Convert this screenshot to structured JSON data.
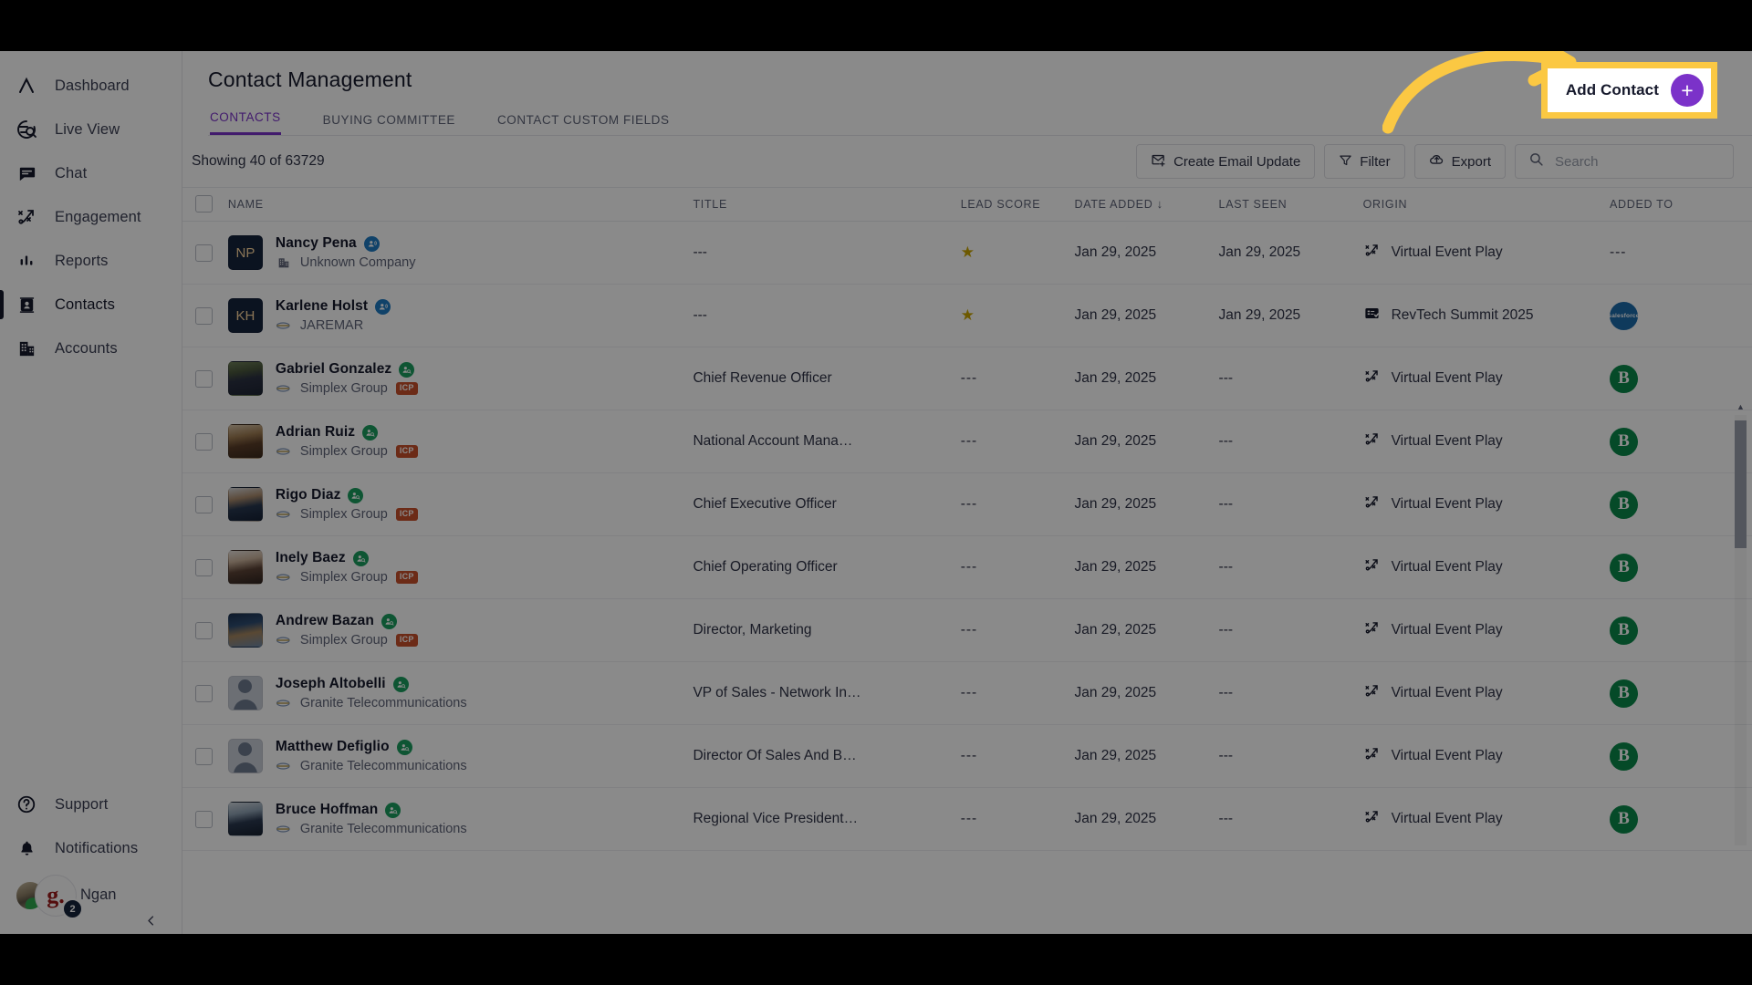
{
  "sidebar": {
    "items": [
      {
        "label": "Dashboard",
        "icon": "dashboard-icon",
        "active": false
      },
      {
        "label": "Live View",
        "icon": "live-view-icon",
        "active": false
      },
      {
        "label": "Chat",
        "icon": "chat-icon",
        "active": false
      },
      {
        "label": "Engagement",
        "icon": "engagement-icon",
        "active": false
      },
      {
        "label": "Reports",
        "icon": "reports-icon",
        "active": false
      },
      {
        "label": "Contacts",
        "icon": "contacts-icon",
        "active": true
      },
      {
        "label": "Accounts",
        "icon": "accounts-icon",
        "active": false
      }
    ],
    "support": "Support",
    "notifications": "Notifications",
    "user": {
      "name": "Ngan",
      "badge_count": "2",
      "avatar_initial": "g."
    }
  },
  "header": {
    "title": "Contact Management",
    "tabs": [
      {
        "label": "CONTACTS",
        "active": true
      },
      {
        "label": "BUYING COMMITTEE",
        "active": false
      },
      {
        "label": "CONTACT CUSTOM FIELDS",
        "active": false
      }
    ],
    "add_contact_label": "Add Contact",
    "add_contact_plus": "+"
  },
  "toolbar": {
    "showing": "Showing 40 of  63729",
    "create_email_update": "Create Email Update",
    "filter": "Filter",
    "export": "Export",
    "search_placeholder": "Search",
    "search_value": ""
  },
  "table": {
    "columns": [
      "NAME",
      "TITLE",
      "LEAD SCORE",
      "DATE ADDED",
      "LAST SEEN",
      "ORIGIN",
      "ADDED TO"
    ],
    "sort_column": "DATE ADDED",
    "sort_dir": "↓",
    "rows": [
      {
        "name": "Nancy Pena",
        "avatar_type": "initials",
        "initials": "NP",
        "pill": "blue",
        "company": "Unknown Company",
        "company_icon": "building-icon",
        "icp": false,
        "title": "---",
        "lead_score": "star",
        "date_added": "Jan 29, 2025",
        "last_seen": "Jan 29, 2025",
        "origin": "Virtual Event Play",
        "origin_icon": "play-icon",
        "added_to": "---"
      },
      {
        "name": "Karlene Holst",
        "avatar_type": "initials",
        "initials": "KH",
        "pill": "blue",
        "company": "JAREMAR",
        "company_icon": "logo-icon",
        "icp": false,
        "title": "---",
        "lead_score": "star",
        "date_added": "Jan 29, 2025",
        "last_seen": "Jan 29, 2025",
        "origin": "RevTech Summit 2025",
        "origin_icon": "form-icon",
        "added_to": "salesforce"
      },
      {
        "name": "Gabriel Gonzalez",
        "avatar_type": "photo-1",
        "initials": "",
        "pill": "green",
        "company": "Simplex Group",
        "company_icon": "logo-icon",
        "icp": true,
        "title": "Chief Revenue Officer",
        "lead_score": "---",
        "date_added": "Jan 29, 2025",
        "last_seen": "---",
        "origin": "Virtual Event Play",
        "origin_icon": "play-icon",
        "added_to": "bombora"
      },
      {
        "name": "Adrian Ruiz",
        "avatar_type": "photo-2",
        "initials": "",
        "pill": "green",
        "company": "Simplex Group",
        "company_icon": "logo-icon",
        "icp": true,
        "title": "National Account Mana…",
        "lead_score": "---",
        "date_added": "Jan 29, 2025",
        "last_seen": "---",
        "origin": "Virtual Event Play",
        "origin_icon": "play-icon",
        "added_to": "bombora"
      },
      {
        "name": "Rigo Diaz",
        "avatar_type": "photo-3",
        "initials": "",
        "pill": "green",
        "company": "Simplex Group",
        "company_icon": "logo-icon",
        "icp": true,
        "title": "Chief Executive Officer",
        "lead_score": "---",
        "date_added": "Jan 29, 2025",
        "last_seen": "---",
        "origin": "Virtual Event Play",
        "origin_icon": "play-icon",
        "added_to": "bombora"
      },
      {
        "name": "Inely Baez",
        "avatar_type": "photo-4",
        "initials": "",
        "pill": "green",
        "company": "Simplex Group",
        "company_icon": "logo-icon",
        "icp": true,
        "title": "Chief Operating Officer",
        "lead_score": "---",
        "date_added": "Jan 29, 2025",
        "last_seen": "---",
        "origin": "Virtual Event Play",
        "origin_icon": "play-icon",
        "added_to": "bombora"
      },
      {
        "name": "Andrew Bazan",
        "avatar_type": "photo-5",
        "initials": "",
        "pill": "green",
        "company": "Simplex Group",
        "company_icon": "logo-icon",
        "icp": true,
        "title": "Director, Marketing",
        "lead_score": "---",
        "date_added": "Jan 29, 2025",
        "last_seen": "---",
        "origin": "Virtual Event Play",
        "origin_icon": "play-icon",
        "added_to": "bombora"
      },
      {
        "name": "Joseph Altobelli",
        "avatar_type": "placeholder",
        "initials": "",
        "pill": "green",
        "company": "Granite Telecommunications",
        "company_icon": "logo-icon",
        "icp": false,
        "title": "VP of Sales - Network In…",
        "lead_score": "---",
        "date_added": "Jan 29, 2025",
        "last_seen": "---",
        "origin": "Virtual Event Play",
        "origin_icon": "play-icon",
        "added_to": "bombora"
      },
      {
        "name": "Matthew Defiglio",
        "avatar_type": "placeholder",
        "initials": "",
        "pill": "green",
        "company": "Granite Telecommunications",
        "company_icon": "logo-icon",
        "icp": false,
        "title": "Director Of Sales And B…",
        "lead_score": "---",
        "date_added": "Jan 29, 2025",
        "last_seen": "---",
        "origin": "Virtual Event Play",
        "origin_icon": "play-icon",
        "added_to": "bombora"
      },
      {
        "name": "Bruce Hoffman",
        "avatar_type": "photo-6",
        "initials": "",
        "pill": "green",
        "company": "Granite Telecommunications",
        "company_icon": "logo-icon",
        "icp": false,
        "title": "Regional Vice President…",
        "lead_score": "---",
        "date_added": "Jan 29, 2025",
        "last_seen": "---",
        "origin": "Virtual Event Play",
        "origin_icon": "play-icon",
        "added_to": "bombora"
      }
    ],
    "icp_label": "ICP",
    "salesforce_label": "salesforce",
    "bombora_label": "B"
  },
  "colors": {
    "accent": "#7b32c9",
    "highlight": "#fbc843",
    "icp": "#c8512c",
    "star": "#c9a400",
    "salesforce": "#1c6bab",
    "bombora": "#0b8a4a"
  }
}
